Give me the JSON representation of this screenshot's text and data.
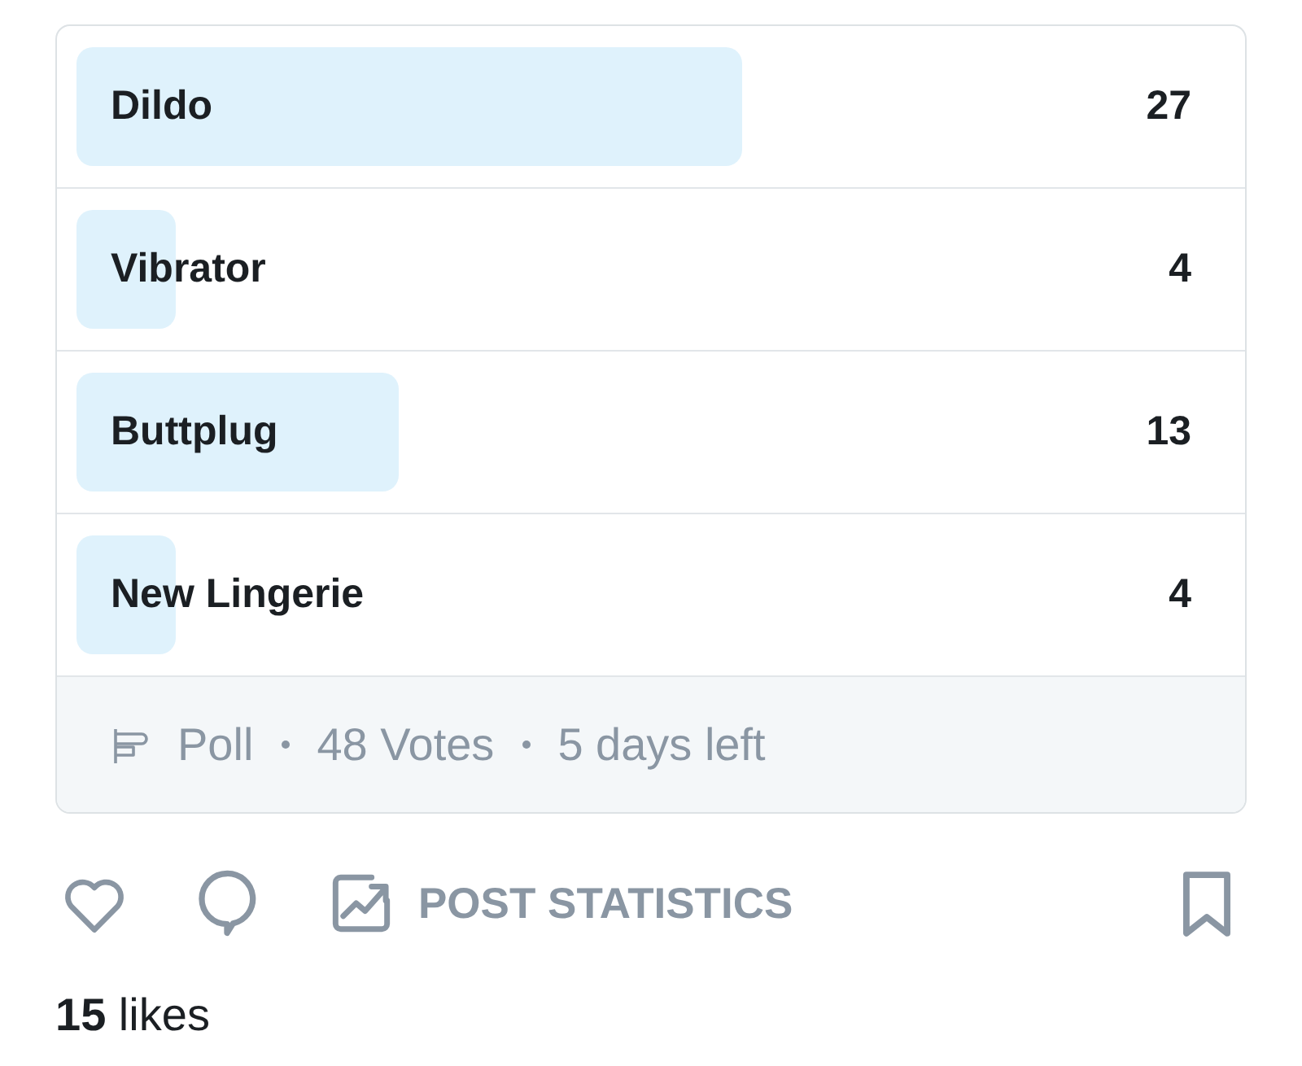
{
  "poll": {
    "options": [
      {
        "label": "Dildo",
        "count": "27",
        "level": 0.58
      },
      {
        "label": "Vibrator",
        "count": "4",
        "level": 0.086
      },
      {
        "label": "Buttplug",
        "count": "13",
        "level": 0.28
      },
      {
        "label": "New Lingerie",
        "count": "4",
        "level": 0.086
      }
    ],
    "footer": {
      "type_label": "Poll",
      "votes": "48 Votes",
      "time_left": "5 days left"
    }
  },
  "actions": {
    "statistics_label": "POST STATISTICS"
  },
  "likes": "**15** likes"
}
